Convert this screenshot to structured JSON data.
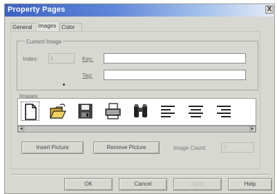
{
  "window": {
    "title": "Property Pages",
    "close_glyph": "X"
  },
  "tabs": [
    {
      "label": "General",
      "active": false
    },
    {
      "label": "Images",
      "active": true
    },
    {
      "label": "Color",
      "active": false
    }
  ],
  "current_image": {
    "group_label": "Current Image",
    "index_label": "Index:",
    "index_value": "1",
    "key_label": "Key:",
    "key_value": "",
    "tag_label": "Tag:",
    "tag_value": ""
  },
  "images": {
    "label": "Images:",
    "icons": [
      "new-document-icon",
      "open-folder-icon",
      "save-disk-icon",
      "printer-icon",
      "binoculars-find-icon",
      "align-left-icon",
      "align-center-icon",
      "align-right-icon"
    ],
    "selected_index": 0
  },
  "actions": {
    "insert_label": "Insert Picture",
    "remove_label": "Remove Picture",
    "count_label": "Image Count:",
    "count_value": "8"
  },
  "footer": {
    "ok": "OK",
    "cancel": "Cancel",
    "apply": "Apply",
    "help": "Help"
  },
  "colors": {
    "title_start": "#3c62c0",
    "title_end": "#e4ecf8",
    "dialog_bg": "#d8d8d2"
  }
}
